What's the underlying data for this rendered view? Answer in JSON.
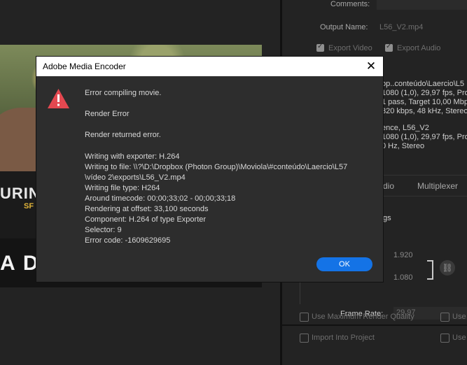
{
  "dialog": {
    "title": "Adobe Media Encoder",
    "heading": "Error compiling movie.",
    "render_error": "Render Error",
    "render_returned": "Render returned error.",
    "details": [
      "Writing with exporter: H.264",
      "Writing to file: \\\\?\\D:\\Dropbox (Photon Group)\\Moviola\\#conteúdo\\Laercio\\L57",
      "\\vídeo 2\\exports\\L56_V2.mp4",
      "Writing file type: H264",
      "Around timecode: 00;00;33;02 - 00;00;33;18",
      "Rendering at offset: 33,100 seconds",
      "Component: H.264 of type Exporter",
      "Selector: 9",
      "Error code: -1609629695"
    ],
    "ok_label": "OK"
  },
  "export_settings": {
    "comments_label": "Comments:",
    "output_name_label": "Output Name:",
    "output_name_value": "L56_V2.mp4",
    "export_video_label": "Export Video",
    "export_audio_label": "Export Audio",
    "export_video_checked": true,
    "export_audio_checked": true,
    "summary_lines_1": [
      "op..conteúdo\\Laercio\\L5",
      "1080 (1,0), 29,97 fps, Pro",
      "1 pass, Target 10,00 Mbp",
      "320 kbps, 48 kHz, Stereo"
    ],
    "summary_lines_2": [
      "ence, L56_V2",
      "1080 (1,0), 29,97 fps, Pro",
      "0 Hz, Stereo"
    ],
    "tabs": [
      "dio",
      "Multiplexer"
    ],
    "section_fragment": "gs",
    "width_value": "1.920",
    "height_value": "1.080",
    "frame_rate_label": "Frame Rate:",
    "frame_rate_value": "29,97",
    "use_max_render_quality": "Use Maximum Render Quality",
    "use_right_1": "Use",
    "import_into_project": "Import Into Project",
    "use_right_2": "Use"
  },
  "preview": {
    "overlay_1": "URIN",
    "overlay_sub": "SF",
    "overlay_2": "A D"
  },
  "colors": {
    "accent": "#1473e6",
    "error_icon": "#e34850",
    "dialog_bg": "#2d2d2d"
  }
}
